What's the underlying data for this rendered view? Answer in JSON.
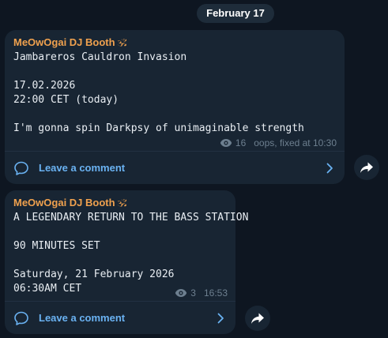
{
  "date_separator": "February 17",
  "colors": {
    "background": "#0e1621",
    "bubble": "#182533",
    "sender": "#f0a14e",
    "link": "#6ab2f2",
    "meta": "#6d7f8f"
  },
  "messages": [
    {
      "sender": "MeOwOgai DJ Booth",
      "sender_emoji": "🕉",
      "text": "Jambareros Cauldron Invasion\n\n17.02.2026\n22:00 CET (today)\n\nI'm gonna spin Darkpsy of unimaginable strength",
      "views": "16",
      "edited_note": "oops, fixed at 10:30",
      "comment_label": "Leave a comment"
    },
    {
      "sender": "MeOwOgai DJ Booth",
      "sender_emoji": "🕉",
      "text": "A LEGENDARY RETURN TO THE BASS STATION\n\n90 MINUTES SET\n\nSaturday, 21 February 2026\n06:30AM CET",
      "views": "3",
      "time": "16:53",
      "comment_label": "Leave a comment"
    }
  ],
  "icons": {
    "views": "eye-icon",
    "comment": "comment-bubble-icon",
    "chevron": "chevron-right-icon",
    "share": "share-arrow-icon"
  }
}
